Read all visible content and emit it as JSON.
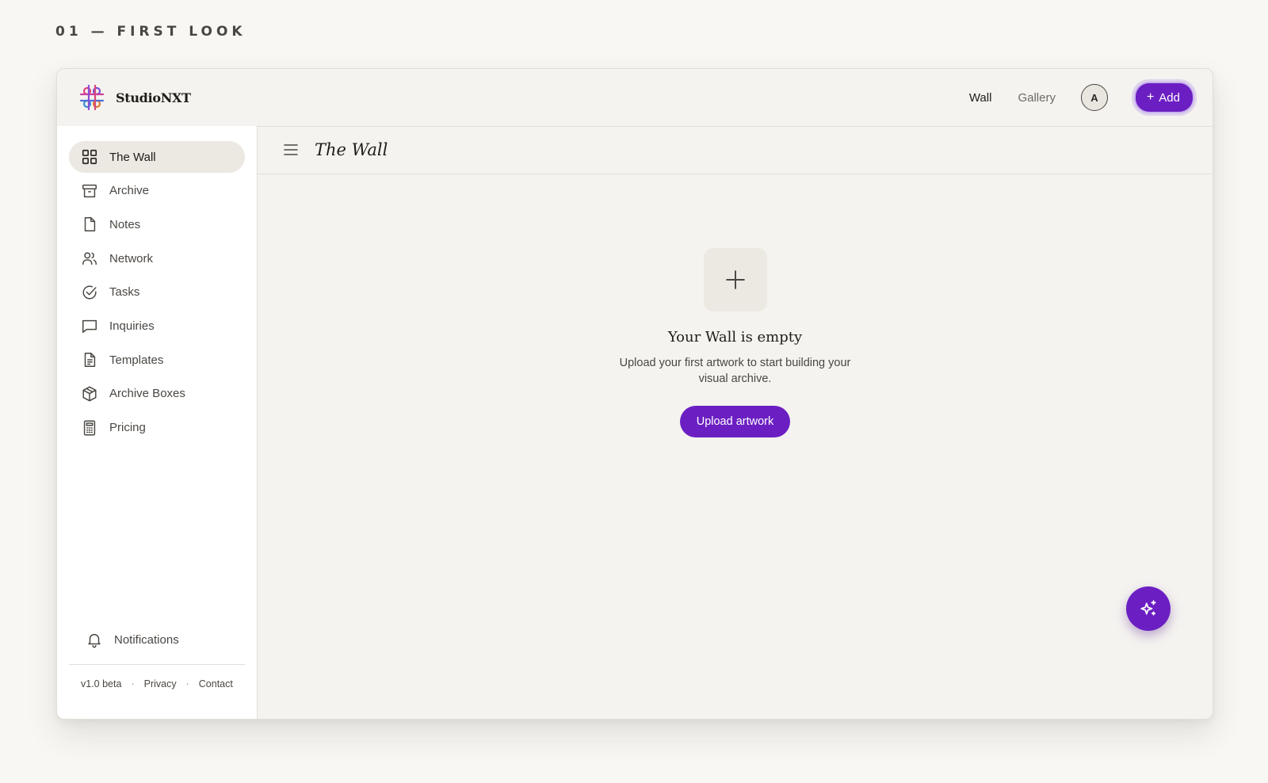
{
  "caption": "01 — FIRST LOOK",
  "brand": {
    "name": "StudioNXT",
    "logo_icon": "knot-logo-icon"
  },
  "topnav": {
    "wall": "Wall",
    "gallery": "Gallery",
    "avatar_initial": "A",
    "add_label": "Add"
  },
  "sidebar": {
    "items": [
      {
        "label": "The Wall",
        "icon": "grid-icon",
        "active": true
      },
      {
        "label": "Archive",
        "icon": "archive-icon"
      },
      {
        "label": "Notes",
        "icon": "note-icon"
      },
      {
        "label": "Network",
        "icon": "users-icon"
      },
      {
        "label": "Tasks",
        "icon": "check-circle-icon"
      },
      {
        "label": "Inquiries",
        "icon": "message-icon"
      },
      {
        "label": "Templates",
        "icon": "document-icon"
      },
      {
        "label": "Archive Boxes",
        "icon": "box-icon"
      },
      {
        "label": "Pricing",
        "icon": "calculator-icon"
      }
    ],
    "notifications": "Notifications",
    "footer": {
      "version": "v1.0 beta",
      "privacy": "Privacy",
      "contact": "Contact"
    }
  },
  "main": {
    "title": "The Wall",
    "empty": {
      "title": "Your Wall is empty",
      "text": "Upload your first artwork to start building your visual archive.",
      "button": "Upload artwork"
    }
  },
  "colors": {
    "accent": "#6b1fc2",
    "background": "#f5f3f0",
    "sidebar_bg": "#ffffff",
    "active_item_bg": "#ece8e2"
  }
}
